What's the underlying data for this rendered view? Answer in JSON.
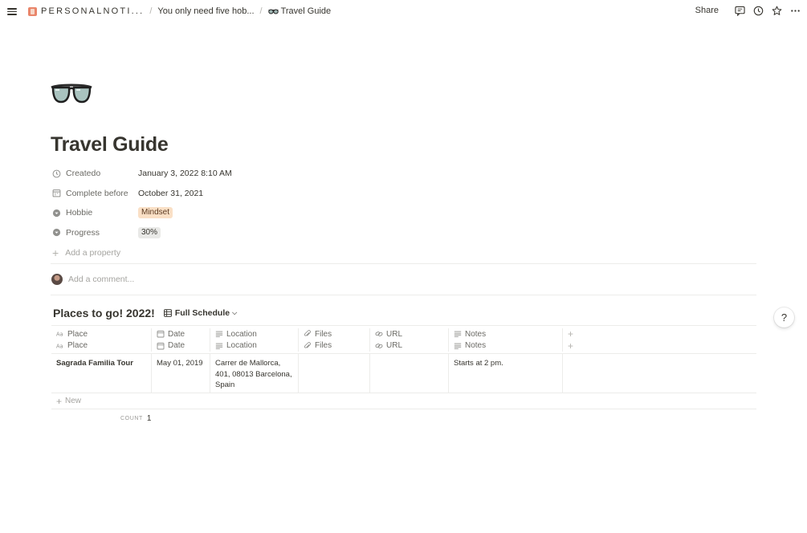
{
  "topbar": {
    "breadcrumbs": [
      "PERSONALNOTI...",
      "You only need five hob...",
      "Travel Guide"
    ],
    "share_label": "Share"
  },
  "page": {
    "icon": "sunglasses-icon",
    "title": "Travel Guide"
  },
  "properties": [
    {
      "name": "Createdo",
      "value": "January 3, 2022 8:10 AM",
      "icon": "clock-icon"
    },
    {
      "name": "Complete before",
      "value": "October 31, 2021",
      "icon": "calendar-icon"
    },
    {
      "name": "Hobbie",
      "value": "Mindset",
      "icon": "select-icon",
      "tag_color": "#fae0c6"
    },
    {
      "name": "Progress",
      "value": "30%",
      "icon": "select-icon",
      "tag_color": "#e9e9e7"
    }
  ],
  "add_property_label": "Add a property",
  "comment_placeholder": "Add a comment...",
  "database": {
    "title": "Places to go! 2022!",
    "view_label": "Full Schedule",
    "columns": [
      "Place",
      "Date",
      "Location",
      "Files",
      "URL",
      "Notes"
    ],
    "rows": [
      {
        "place": "Sagrada Familia Tour",
        "date": "May 01, 2019",
        "location": "Carrer de Mallorca, 401, 08013 Barcelona, Spain",
        "files": "",
        "url": "",
        "notes": "Starts at 2 pm."
      }
    ],
    "new_label": "New",
    "count_label": "COUNT",
    "count_value": "1"
  },
  "help_label": "?"
}
